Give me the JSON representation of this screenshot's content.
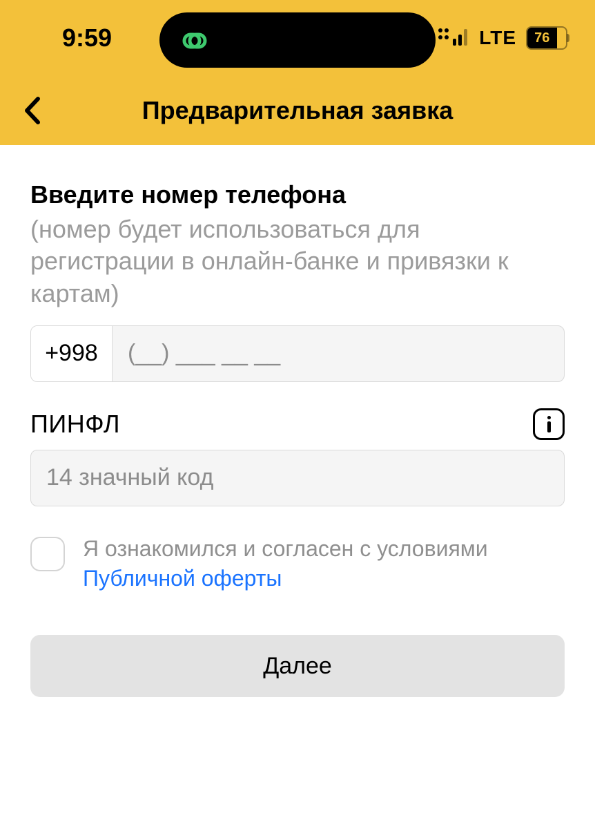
{
  "status": {
    "time": "9:59",
    "network": "LTE",
    "battery": "76"
  },
  "nav": {
    "title": "Предварительная заявка"
  },
  "phone": {
    "label": "Введите номер телефона",
    "sub": "(номер будет использоваться для регистрации в онлайн-банке и привязки к картам)",
    "prefix": "+998",
    "placeholder": "(__) ___ __ __"
  },
  "pinfl": {
    "label": "ПИНФЛ",
    "placeholder": "14 значный код"
  },
  "consent": {
    "text": "Я ознакомился и согласен с условиями",
    "link": "Публичной оферты"
  },
  "next_label": "Далее"
}
